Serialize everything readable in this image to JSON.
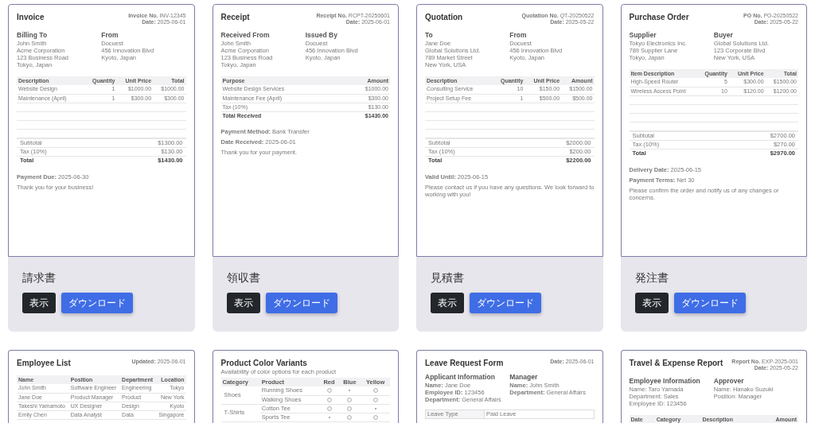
{
  "cards": [
    {
      "document": {
        "title": "Invoice",
        "meta": [
          "**Invoice No.** INV-12345",
          "**Date:** 2025-06-01"
        ],
        "sections": [
          {
            "kind": "parties",
            "columns": [
              {
                "heading": "Billing To",
                "lines": [
                  "John Smith",
                  "Acme Corporation",
                  "123 Business Road",
                  "Tokyo, Japan"
                ]
              },
              {
                "heading": "From",
                "lines": [
                  "Docuest",
                  "456 Innovation Blvd",
                  "Kyoto, Japan"
                ]
              }
            ]
          },
          {
            "kind": "table",
            "columns": [
              {
                "label": "Description",
                "right_aligned": false
              },
              {
                "label": "Quantity",
                "right_aligned": true
              },
              {
                "label": "Unit Price",
                "right_aligned": true
              },
              {
                "label": "Total",
                "right_aligned": true
              }
            ],
            "rows": [
              [
                "Website Design",
                "1",
                "$1000.00",
                "$1000.00"
              ],
              [
                "Maintenance (April)",
                "1",
                "$300.00",
                "$300.00"
              ]
            ]
          },
          {
            "kind": "totals",
            "rows": [
              {
                "label": "Subtotal",
                "value": "$1300.00",
                "grand": false
              },
              {
                "label": "Tax (10%)",
                "value": "$130.00",
                "grand": false
              },
              {
                "label": "Total",
                "value": "$1430.00",
                "grand": true
              }
            ]
          },
          {
            "kind": "notes",
            "lines": [
              "**Payment Due:** 2025-06-30",
              "Thank you for your business!"
            ]
          }
        ]
      },
      "label": "請求書",
      "buttons": [
        {
          "label": "表示",
          "kind": "dark"
        },
        {
          "label": "ダウンロード",
          "kind": "primary"
        }
      ]
    },
    {
      "document": {
        "title": "Receipt",
        "meta": [
          "**Receipt No.** RCPT-20250601",
          "**Date:** 2025-06-01"
        ],
        "sections": [
          {
            "kind": "parties",
            "columns": [
              {
                "heading": "Received From",
                "lines": [
                  "John Smith",
                  "Acme Corporation",
                  "123 Business Road",
                  "Tokyo, Japan"
                ]
              },
              {
                "heading": "Issued By",
                "lines": [
                  "Docuest",
                  "456 Innovation Blvd",
                  "Kyoto, Japan"
                ]
              }
            ]
          },
          {
            "kind": "table",
            "columns": [
              {
                "label": "Purpose",
                "right_aligned": false
              },
              {
                "label": "Amount",
                "right_aligned": true
              }
            ],
            "rows": [
              [
                "Website Design Services",
                "$1000.00"
              ],
              [
                "Maintenance Fee (April)",
                "$300.00"
              ],
              [
                "Tax (10%)",
                "$130.00"
              ]
            ],
            "footer": [
              "Total Received",
              "$1430.00"
            ]
          },
          {
            "kind": "notes",
            "lines": [
              "**Payment Method:** Bank Transfer",
              "**Date Received:** 2025-06-01",
              "Thank you for your payment."
            ]
          }
        ]
      },
      "label": "領収書",
      "buttons": [
        {
          "label": "表示",
          "kind": "dark"
        },
        {
          "label": "ダウンロード",
          "kind": "primary"
        }
      ]
    },
    {
      "document": {
        "title": "Quotation",
        "meta": [
          "**Quotation No.** QT-20250522",
          "**Date:** 2025-05-22"
        ],
        "sections": [
          {
            "kind": "parties",
            "columns": [
              {
                "heading": "To",
                "lines": [
                  "Jane Doe",
                  "Global Solutions Ltd.",
                  "789 Market Street",
                  "New York, USA"
                ]
              },
              {
                "heading": "From",
                "lines": [
                  "Docuest",
                  "456 Innovation Blvd",
                  "Kyoto, Japan"
                ]
              }
            ]
          },
          {
            "kind": "table",
            "columns": [
              {
                "label": "Description",
                "right_aligned": false
              },
              {
                "label": "Quantity",
                "right_aligned": true
              },
              {
                "label": "Unit Price",
                "right_aligned": true
              },
              {
                "label": "Amount",
                "right_aligned": true
              }
            ],
            "rows": [
              [
                "Consulting Service",
                "10",
                "$150.00",
                "$1500.00"
              ],
              [
                "Project Setup Fee",
                "1",
                "$500.00",
                "$500.00"
              ]
            ]
          },
          {
            "kind": "totals",
            "rows": [
              {
                "label": "Subtotal",
                "value": "$2000.00",
                "grand": false
              },
              {
                "label": "Tax (10%)",
                "value": "$200.00",
                "grand": false
              },
              {
                "label": "Total",
                "value": "$2200.00",
                "grand": true
              }
            ]
          },
          {
            "kind": "notes",
            "lines": [
              "**Valid Until:** 2025-06-15",
              "Please contact us if you have any questions. We look forward to working with you!"
            ]
          }
        ]
      },
      "label": "見積書",
      "buttons": [
        {
          "label": "表示",
          "kind": "dark"
        },
        {
          "label": "ダウンロード",
          "kind": "primary"
        }
      ]
    },
    {
      "document": {
        "title": "Purchase Order",
        "meta": [
          "**PO No.** PO-20250522",
          "**Date:** 2025-05-22"
        ],
        "sections": [
          {
            "kind": "parties",
            "columns": [
              {
                "heading": "Supplier",
                "lines": [
                  "Tokyo Electronics Inc.",
                  "789 Supplier Lane",
                  "Tokyo, Japan"
                ]
              },
              {
                "heading": "Buyer",
                "lines": [
                  "Global Solutions Ltd.",
                  "123 Corporate Blvd",
                  "New York, USA"
                ]
              }
            ]
          },
          {
            "kind": "table",
            "columns": [
              {
                "label": "Item Description",
                "right_aligned": false
              },
              {
                "label": "Quantity",
                "right_aligned": true
              },
              {
                "label": "Unit Price",
                "right_aligned": true
              },
              {
                "label": "Total",
                "right_aligned": true
              }
            ],
            "rows": [
              [
                "High-Speed Router",
                "5",
                "$300.00",
                "$1500.00"
              ],
              [
                "Wireless Access Point",
                "10",
                "$120.00",
                "$1200.00"
              ]
            ]
          },
          {
            "kind": "totals",
            "rows": [
              {
                "label": "Subtotal",
                "value": "$2700.00",
                "grand": false
              },
              {
                "label": "Tax (10%)",
                "value": "$270.00",
                "grand": false
              },
              {
                "label": "Total",
                "value": "$2970.00",
                "grand": true
              }
            ]
          },
          {
            "kind": "notes",
            "lines": [
              "**Delivery Date:** 2025-06-15",
              "**Payment Terms:** Net 30",
              "Please confirm the order and notify us of any changes or concerns."
            ]
          }
        ]
      },
      "label": "発注書",
      "buttons": [
        {
          "label": "表示",
          "kind": "dark"
        },
        {
          "label": "ダウンロード",
          "kind": "primary"
        }
      ]
    },
    {
      "document": {
        "title": "Employee List",
        "meta": [
          "**Updated:** 2025-06-01"
        ],
        "sections": [
          {
            "kind": "table",
            "columns": [
              {
                "label": "Name",
                "right_aligned": false
              },
              {
                "label": "Position",
                "right_aligned": false
              },
              {
                "label": "Department",
                "right_aligned": false
              },
              {
                "label": "Location",
                "right_aligned": true
              }
            ],
            "rows": [
              [
                "John Smith",
                "Software Engineer",
                "Engineering",
                "Tokyo"
              ],
              [
                "Jane Doe",
                "Product Manager",
                "Product",
                "New York"
              ],
              [
                "Takeshi Yamamoto",
                "UX Designer",
                "Design",
                "Kyoto"
              ],
              [
                "Emily Chen",
                "Data Analyst",
                "Data",
                "Singapore"
              ]
            ]
          }
        ]
      }
    },
    {
      "document": {
        "title": "Product Color Variants",
        "sections": [
          {
            "kind": "subtitle",
            "text": "Availability of color options for each product"
          },
          {
            "kind": "matrix",
            "columns": [
              "Category",
              "Product",
              "Red",
              "Blue",
              "Yellow"
            ],
            "groups": [
              {
                "label": "Shoes",
                "items": [
                  {
                    "label": "Running Shoes",
                    "available": [
                      true,
                      false,
                      true
                    ]
                  },
                  {
                    "label": "Walking Shoes",
                    "available": [
                      true,
                      true,
                      true
                    ]
                  }
                ]
              },
              {
                "label": "T-Shirts",
                "items": [
                  {
                    "label": "Cotton Tee",
                    "available": [
                      true,
                      true,
                      false
                    ]
                  },
                  {
                    "label": "Sports Tee",
                    "available": [
                      false,
                      true,
                      true
                    ]
                  }
                ]
              }
            ]
          }
        ]
      }
    },
    {
      "document": {
        "title": "Leave Request Form",
        "meta": [
          "**Date:** 2025-06-01"
        ],
        "sections": [
          {
            "kind": "parties",
            "columns": [
              {
                "heading": "Applicant Information",
                "lines": [
                  "**Name:** Jane Doe",
                  "**Employee ID:** 123456",
                  "**Department:** General Affairs"
                ]
              },
              {
                "heading": "Manager",
                "lines": [
                  "**Name:** John Smith",
                  "**Department:** General Affairs"
                ]
              }
            ]
          },
          {
            "kind": "fields",
            "rows": [
              [
                "Leave Type",
                "Paid Leave"
              ]
            ]
          }
        ]
      }
    },
    {
      "document": {
        "title": "Travel & Expense Report",
        "meta": [
          "**Report No.** EXP-2025-001",
          "**Date:** 2025-05-22"
        ],
        "sections": [
          {
            "kind": "parties",
            "columns": [
              {
                "heading": "Employee Information",
                "lines": [
                  "Name: Taro Yamada",
                  "Department: Sales",
                  "Employee ID: 123456"
                ]
              },
              {
                "heading": "Approver",
                "lines": [
                  "Name: Hanako Suzuki",
                  "Position: Manager"
                ]
              }
            ]
          },
          {
            "kind": "table",
            "columns": [
              {
                "label": "Date",
                "right_aligned": false
              },
              {
                "label": "Category",
                "right_aligned": false
              },
              {
                "label": "Description",
                "right_aligned": false
              },
              {
                "label": "Amount",
                "right_aligned": true
              }
            ]
          }
        ]
      }
    }
  ]
}
